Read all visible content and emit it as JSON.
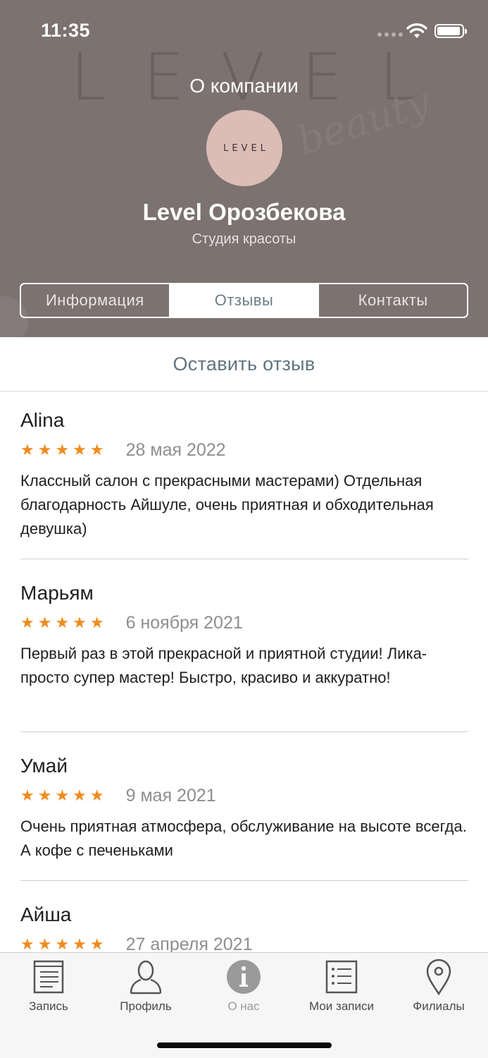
{
  "status_bar": {
    "time": "11:35"
  },
  "header": {
    "title": "О компании",
    "logo_text": "LEVEL",
    "company_name": "Level Орозбекова",
    "company_subtitle": "Студия красоты",
    "segments": [
      {
        "label": "Информация",
        "active": false
      },
      {
        "label": "Отзывы",
        "active": true
      },
      {
        "label": "Контакты",
        "active": false
      }
    ]
  },
  "leave_review_label": "Оставить отзыв",
  "reviews": [
    {
      "author": "Alina",
      "rating": 5,
      "stars": "★★★★★",
      "date": "28 мая 2022",
      "text": "Классный салон с прекрасными мастерами) Отдельная благодарность Айшуле, очень приятная и обходительная девушка)"
    },
    {
      "author": "Марьям",
      "rating": 5,
      "stars": "★★★★★",
      "date": "6 ноября 2021",
      "text": "Первый раз в этой прекрасной и приятной студии! Лика-просто супер мастер! Быстро, красиво и аккуратно!"
    },
    {
      "author": "Умай",
      "rating": 5,
      "stars": "★★★★★",
      "date": "9 мая 2021",
      "text": "Очень приятная атмосфера, обслуживание на высоте всегда. А кофе с печеньками"
    },
    {
      "author": "Айша",
      "rating": 5,
      "stars": "★★★★★",
      "date": "27 апреля 2021",
      "text": ""
    }
  ],
  "tab_bar": {
    "items": [
      {
        "label": "Запись",
        "icon": "document-icon",
        "active": false
      },
      {
        "label": "Профиль",
        "icon": "person-icon",
        "active": false
      },
      {
        "label": "О нас",
        "icon": "info-icon",
        "active": true
      },
      {
        "label": "Мои записи",
        "icon": "list-icon",
        "active": false
      },
      {
        "label": "Филиалы",
        "icon": "location-pin-icon",
        "active": false
      }
    ]
  },
  "colors": {
    "header_bg": "#7c7270",
    "accent": "#5f7480",
    "star": "#f08b1e",
    "logo_bg": "#dcbdb6"
  }
}
